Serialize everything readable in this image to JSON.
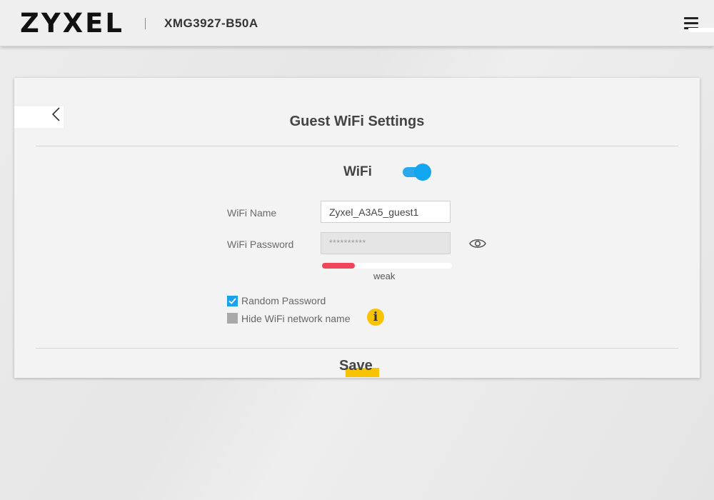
{
  "header": {
    "brand": "ZYXEL",
    "model": "XMG3927-B50A"
  },
  "page": {
    "title": "Guest WiFi Settings",
    "wifi_label": "WiFi",
    "wifi_enabled": true
  },
  "form": {
    "wifi_name_label": "WiFi Name",
    "wifi_name_value": "Zyxel_A3A5_guest1",
    "wifi_password_label": "WiFi Password",
    "wifi_password_value": "**********",
    "password_strength": {
      "text": "weak",
      "level": 0.25,
      "color": "#f0455a"
    },
    "random_password_label": "Random Password",
    "random_password_checked": true,
    "hide_name_label": "Hide WiFi network name",
    "hide_name_checked": false,
    "info_icon_glyph": "i"
  },
  "footer": {
    "save_label": "Save"
  },
  "colors": {
    "accent_blue": "#12a6f0",
    "highlight_yellow": "#f8c300",
    "weak_red": "#f0455a"
  },
  "icons": [
    "hamburger-menu-icon",
    "chevron-left-icon",
    "eye-icon",
    "info-icon",
    "checkmark-icon"
  ]
}
